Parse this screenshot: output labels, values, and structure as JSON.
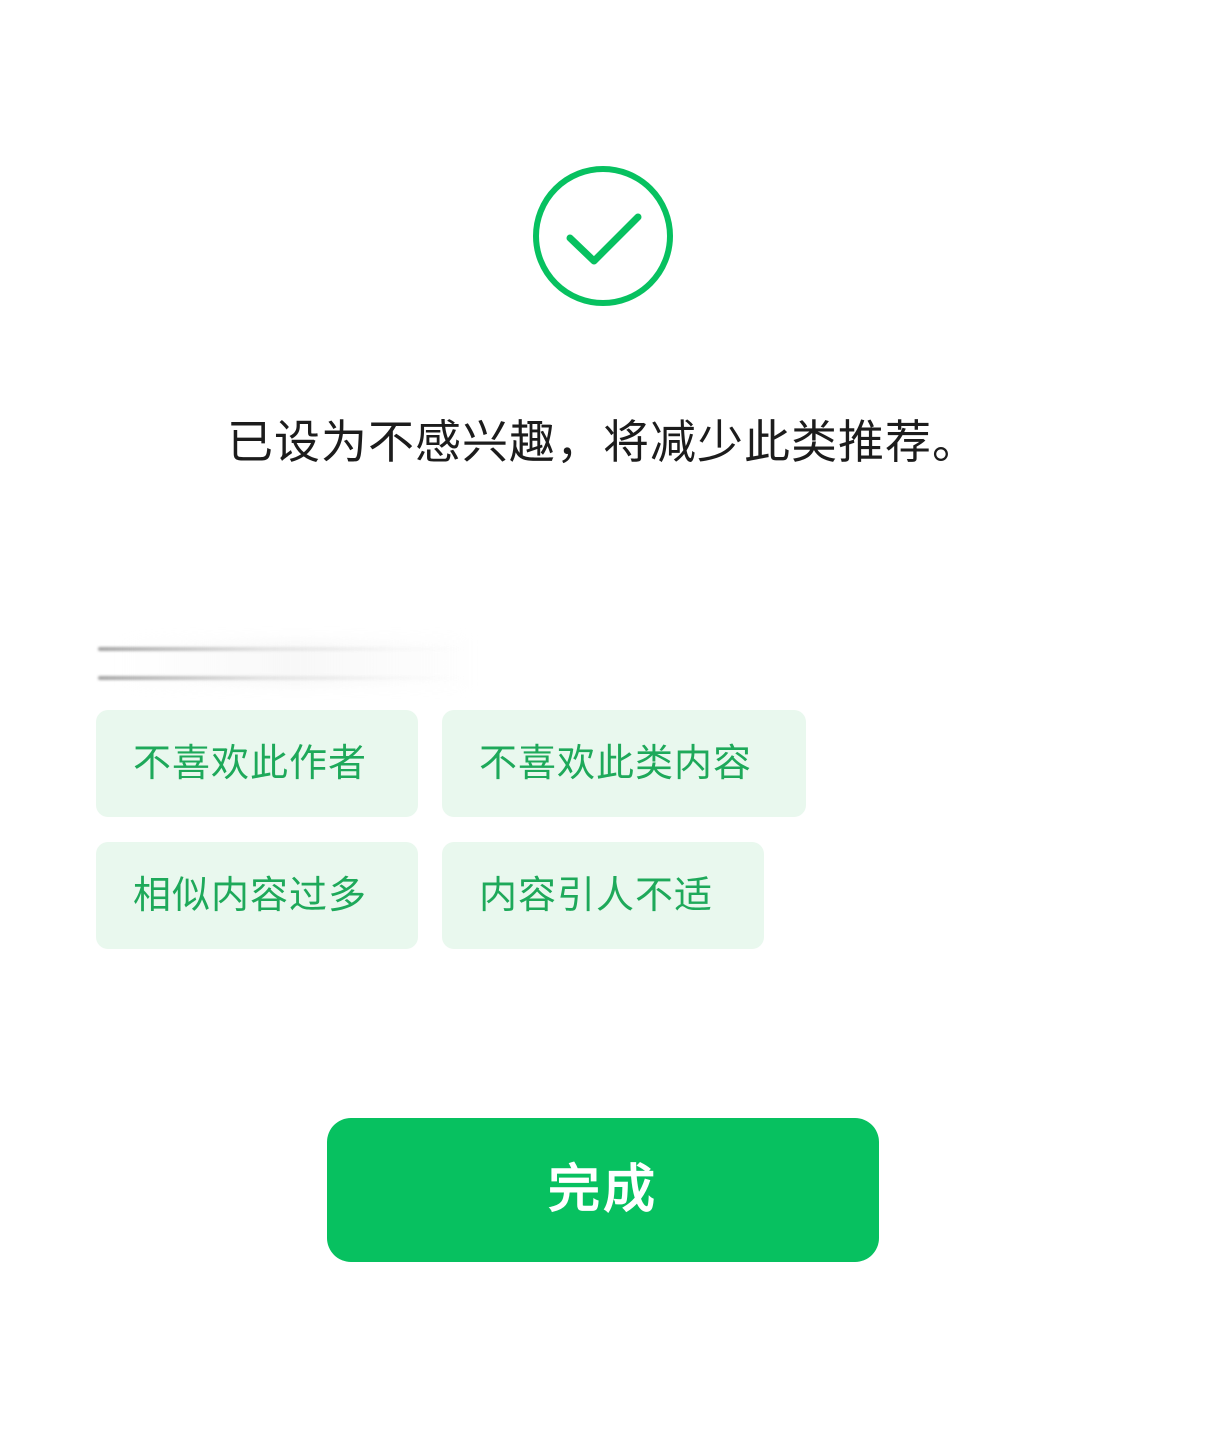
{
  "status": {
    "icon": "check-circle-icon",
    "message": "已设为不感兴趣，将减少此类推荐。"
  },
  "feedback": {
    "options": [
      {
        "label": "不喜欢此作者"
      },
      {
        "label": "不喜欢此类内容"
      },
      {
        "label": "相似内容过多"
      },
      {
        "label": "内容引人不适"
      }
    ]
  },
  "actions": {
    "done_label": "完成"
  },
  "colors": {
    "accent": "#07c160",
    "chip_bg": "#e9f8ee",
    "chip_text": "#1ea95a",
    "text_primary": "#1c1c1c"
  }
}
